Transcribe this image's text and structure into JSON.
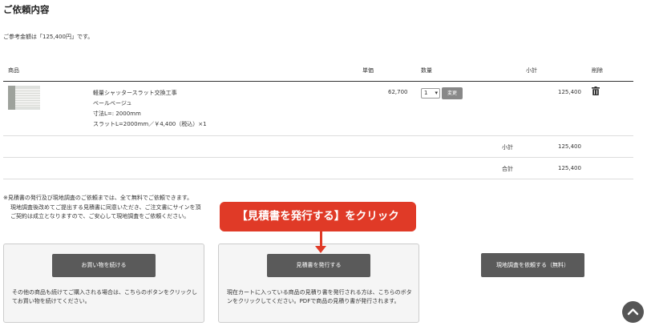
{
  "page": {
    "title": "ご依頼内容",
    "reference_text": "ご参考金額は「125,400円」です。"
  },
  "table": {
    "headers": {
      "product": "商品",
      "unit_price": "単価",
      "quantity": "数量",
      "subtotal": "小計",
      "delete": "削除"
    },
    "item": {
      "name": "軽量シャッタースラット交換工事",
      "color": "ベールベージュ",
      "size": "寸法L=: 2000mm",
      "slat": "スラットL=2000mm／￥4,400（税込）×1",
      "unit_price": "62,700",
      "quantity": "1",
      "change_label": "変更",
      "subtotal": "125,400",
      "thumbnail_icon": "shutter-photo"
    },
    "summary": {
      "subtotal_label": "小計",
      "subtotal_value": "125,400",
      "total_label": "合計",
      "total_value": "125,400"
    }
  },
  "notes": {
    "line1": "※見積書の発行及び現地調査のご依頼までは、全て無料でご依頼できます。",
    "line2": "現地調査後改めてご提出する見積書に同意いただき、ご注文書にサインを頂",
    "line3": "ご契約は成立となりますので、ご安心して現地調査をご依頼ください。"
  },
  "callout": {
    "text": "【見積書を発行する】をクリック",
    "color": "#e03a27"
  },
  "cards": {
    "continue": {
      "button": "お買い物を続ける",
      "text": "その他の商品も続けてご購入される場合は、こちらのボタンをクリックしてお買い物を続けてください。"
    },
    "estimate": {
      "button": "見積書を発行する",
      "text": "現在カートに入っている商品の見積り書を発行される方は、こちらのボタンをクリックしてください。PDFで商品の見積り書が発行されます。"
    }
  },
  "survey_button": "現地調査を依頼する（無料）",
  "colors": {
    "button_bg": "#5a5a5a",
    "accent": "#e03a27"
  }
}
